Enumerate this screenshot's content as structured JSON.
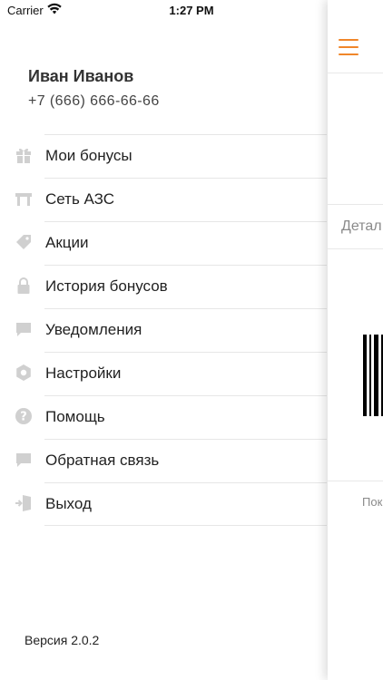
{
  "status_bar": {
    "carrier": "Carrier",
    "time": "1:27 PM"
  },
  "profile": {
    "name": "Иван Иванов",
    "phone": "+7 (666) 666-66-66"
  },
  "menu": [
    {
      "label": "Мои бонусы",
      "icon": "gift-icon"
    },
    {
      "label": "Сеть АЗС",
      "icon": "gas-station-icon"
    },
    {
      "label": "Акции",
      "icon": "tag-icon"
    },
    {
      "label": "История бонусов",
      "icon": "lock-icon"
    },
    {
      "label": "Уведомления",
      "icon": "message-icon"
    },
    {
      "label": "Настройки",
      "icon": "settings-icon"
    },
    {
      "label": "Помощь",
      "icon": "help-icon"
    },
    {
      "label": "Обратная связь",
      "icon": "feedback-icon"
    },
    {
      "label": "Выход",
      "icon": "logout-icon"
    }
  ],
  "version": "Версия 2.0.2",
  "main_panel": {
    "details_label": "Детал",
    "hint_label": "Пок"
  },
  "colors": {
    "accent": "#f0862a",
    "icon_gray": "#d0d0d0",
    "separator": "#e6e6e6"
  }
}
